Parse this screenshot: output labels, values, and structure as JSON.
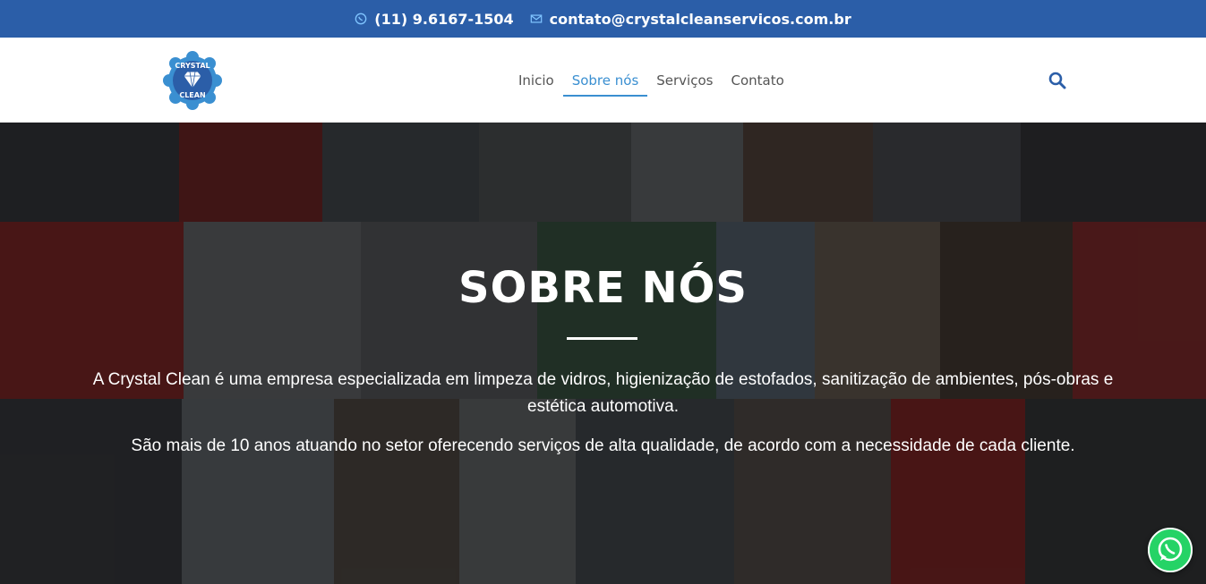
{
  "topbar": {
    "phone": "(11) 9.6167-1504",
    "email": "contato@crystalcleanservicos.com.br",
    "phone_icon": "whatsapp-icon",
    "email_icon": "envelope-icon"
  },
  "logo": {
    "text_top": "CRYSTAL",
    "text_bottom": "CLEAN",
    "icon": "diamond-icon"
  },
  "nav": {
    "items": [
      {
        "label": "Inicio"
      },
      {
        "label": "Sobre nós",
        "active": true
      },
      {
        "label": "Serviços"
      },
      {
        "label": "Contato"
      }
    ]
  },
  "search": {
    "icon": "search-icon"
  },
  "hero": {
    "title": "SOBRE NÓS",
    "paragraph1": "A Crystal Clean é uma empresa especializada em limpeza de vidros, higienização de estofados, sanitização de ambientes, pós-obras e estética automotiva.",
    "paragraph2": "São mais de 10 anos atuando no setor oferecendo serviços de alta qualidade, de acordo com a necessidade de cada cliente."
  },
  "floating": {
    "whatsapp_icon": "whatsapp-icon"
  },
  "colors": {
    "topbar": "#2b5ea8",
    "accent": "#3a8fd1",
    "nav_text": "#555555",
    "whatsapp": "#25d366"
  }
}
